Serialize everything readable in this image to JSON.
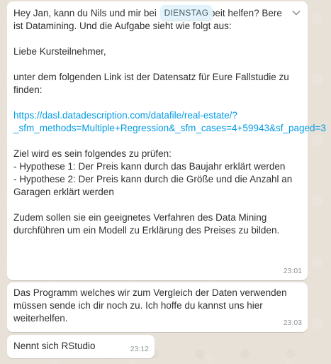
{
  "date_separator": "DIENSTAG",
  "messages": [
    {
      "lines": {
        "intro_1": "Hey Jan, kann du Nils und mir bei",
        "intro_1b": "beit helfen? Bere",
        "intro_2": "ist Datamining. Und die Aufgabe sieht wie folgt aus:",
        "greeting": "Liebe Kursteilnehmer,",
        "body_1": "unter dem folgenden Link ist der Datensatz für Eure Fallstudie zu finden:",
        "link": "https://dasl.datadescription.com/datafile/real-estate/?_sfm_methods=Multiple+Regression&_sfm_cases=4+59943&sf_paged=3",
        "goal_intro": "Ziel wird es sein folgendes zu prüfen:",
        "hypothesis_1": "- Hypothese 1: Der Preis kann durch das Baujahr erklärt werden",
        "hypothesis_2": "- Hypothese 2: Der Preis kann durch die Größe und die Anzahl an Garagen erklärt werden",
        "closing": "Zudem sollen sie ein geeignetes Verfahren des Data Mining durchführen um ein Modell zu Erklärung des Preises zu bilden."
      },
      "time": "23:01"
    },
    {
      "text": "Das Programm welches wir zum Vergleich der Daten verwenden müssen sende ich dir noch zu. Ich hoffe du kannst uns hier weiterhelfen.",
      "time": "23:03"
    },
    {
      "text": "Nennt sich RStudio",
      "time": "23:12"
    }
  ],
  "icons": {
    "message_menu": "chevron-down-icon"
  },
  "colors": {
    "bubble": "#ffffff",
    "link": "#039be5",
    "date_pill": "#e1f3fb",
    "time": "#8f9599"
  }
}
